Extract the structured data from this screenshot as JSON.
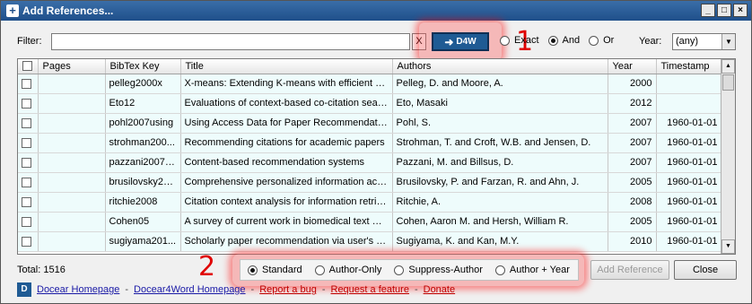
{
  "window": {
    "title": "Add References..."
  },
  "filter": {
    "label": "Filter:",
    "value": "",
    "clear_label": "X",
    "d4w_label": "D4W",
    "marker": "1",
    "match_options": [
      {
        "label": "Exact",
        "selected": false
      },
      {
        "label": "And",
        "selected": true
      },
      {
        "label": "Or",
        "selected": false
      }
    ],
    "year_label": "Year:",
    "year_value": "(any)"
  },
  "table": {
    "headers": [
      "",
      "Pages",
      "BibTex Key",
      "Title",
      "Authors",
      "Year",
      "Timestamp"
    ],
    "rows": [
      {
        "pages": "",
        "key": "pelleg2000x",
        "title": "X-means: Extending K-means with efficient esti...",
        "authors": "Pelleg, D. and Moore, A.",
        "year": "2000",
        "timestamp": ""
      },
      {
        "pages": "",
        "key": "Eto12",
        "title": "Evaluations of context-based co-citation searc...",
        "authors": "Eto, Masaki",
        "year": "2012",
        "timestamp": ""
      },
      {
        "pages": "",
        "key": "pohl2007using",
        "title": "Using Access Data for Paper Recommendatio...",
        "authors": "Pohl, S.",
        "year": "2007",
        "timestamp": "1960-01-01"
      },
      {
        "pages": "",
        "key": "strohman200...",
        "title": "Recommending citations for academic papers",
        "authors": "Strohman, T. and Croft, W.B. and Jensen, D.",
        "year": "2007",
        "timestamp": "1960-01-01"
      },
      {
        "pages": "",
        "key": "pazzani2007c...",
        "title": "Content-based recommendation systems",
        "authors": "Pazzani, M. and Billsus, D.",
        "year": "2007",
        "timestamp": "1960-01-01"
      },
      {
        "pages": "",
        "key": "brusilovsky20...",
        "title": "Comprehensive personalized information acces...",
        "authors": "Brusilovsky, P. and Farzan, R. and Ahn, J.",
        "year": "2005",
        "timestamp": "1960-01-01"
      },
      {
        "pages": "",
        "key": "ritchie2008",
        "title": "Citation context analysis for information retrieval",
        "authors": "Ritchie, A.",
        "year": "2008",
        "timestamp": "1960-01-01"
      },
      {
        "pages": "",
        "key": "Cohen05",
        "title": "A survey of current work in biomedical text mini...",
        "authors": "Cohen, Aaron M. and Hersh, William R.",
        "year": "2005",
        "timestamp": "1960-01-01"
      },
      {
        "pages": "",
        "key": "sugiyama201...",
        "title": "Scholarly paper recommendation via user's rec...",
        "authors": "Sugiyama, K. and Kan, M.Y.",
        "year": "2010",
        "timestamp": "1960-01-01"
      }
    ]
  },
  "footer": {
    "total": "Total: 1516",
    "marker": "2",
    "style_options": [
      {
        "label": "Standard",
        "selected": true
      },
      {
        "label": "Author-Only",
        "selected": false
      },
      {
        "label": "Suppress-Author",
        "selected": false
      },
      {
        "label": "Author + Year",
        "selected": false
      }
    ],
    "add_label": "Add Reference",
    "close_label": "Close",
    "links": [
      {
        "label": "Docear Homepage",
        "color": "blue"
      },
      {
        "label": "Docear4Word Homepage",
        "color": "blue"
      },
      {
        "label": "Report a bug",
        "color": "red"
      },
      {
        "label": "Request a feature",
        "color": "red"
      },
      {
        "label": "Donate",
        "color": "red"
      }
    ]
  }
}
